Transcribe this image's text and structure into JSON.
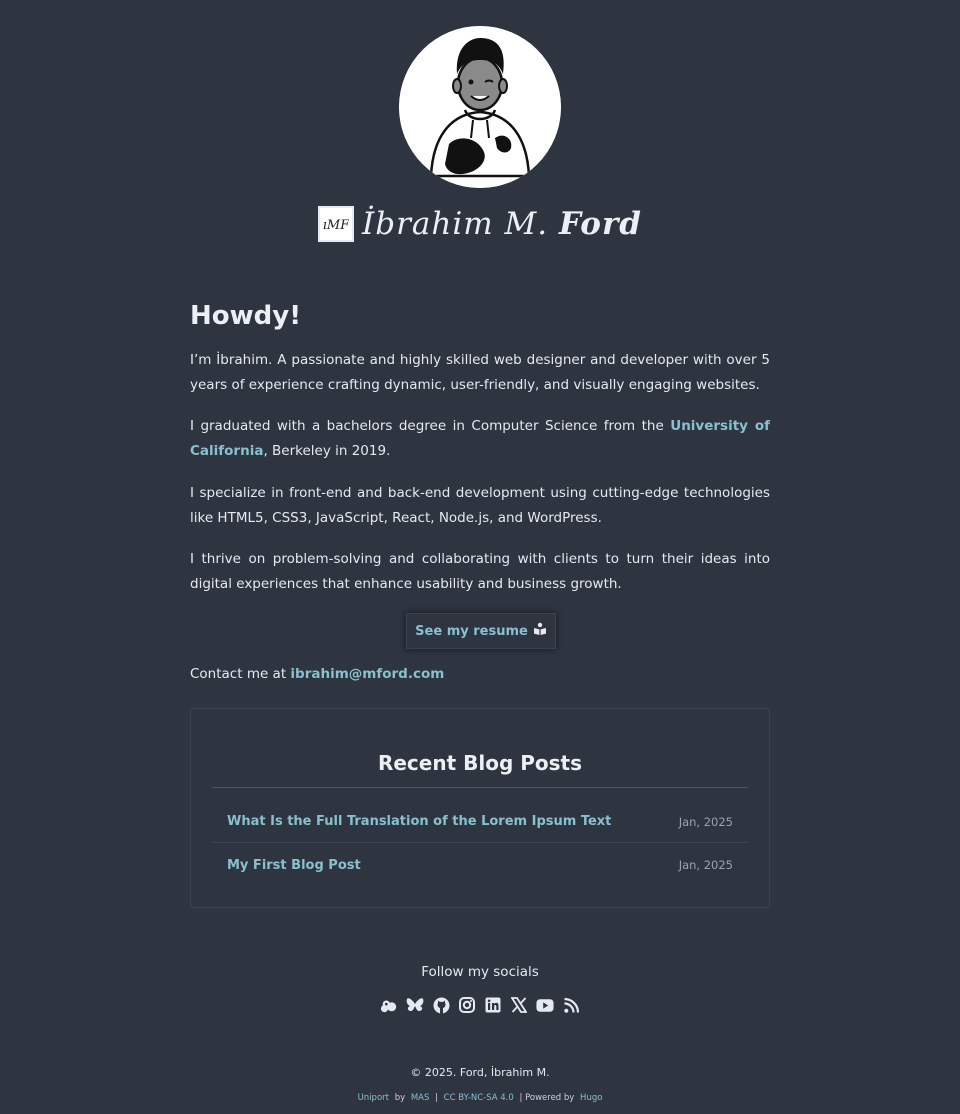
{
  "header": {
    "site_name_part1": "İbrahim M.",
    "site_name_part2": "Ford"
  },
  "main": {
    "heading": "Howdy!",
    "p1": "I’m İbrahim. A passionate and highly skilled web designer and developer with over 5 years of experience crafting dynamic, user-friendly, and visually engaging websites.",
    "p2_before": "I graduated with a bachelors degree in Computer Science from the ",
    "p2_link": "University of California",
    "p2_after": ", Berkeley in 2019.",
    "p3": "I specialize in front-end and back-end development using cutting-edge technologies like HTML5, CSS3, JavaScript, React, Node.js, and WordPress.",
    "p4": "I thrive on problem-solving and collaborating with clients to turn their ideas into digital experiences that enhance usability and business growth.",
    "resume_label": "See my resume",
    "contact_prefix": "Contact me at ",
    "contact_email": "ibrahim@mford.com"
  },
  "blog": {
    "heading": "Recent Blog Posts",
    "posts": [
      {
        "title": "What Is the Full Translation of the Lorem Ipsum Text",
        "date": "Jan, 2025"
      },
      {
        "title": "My First Blog Post",
        "date": "Jan, 2025"
      }
    ]
  },
  "socials": {
    "label": "Follow my socials",
    "icons": [
      "mastodon-icon",
      "bluesky-icon",
      "github-icon",
      "instagram-icon",
      "linkedin-icon",
      "x-icon",
      "youtube-icon",
      "rss-icon"
    ]
  },
  "footer": {
    "copyright": "© 2025. Ford, İbrahim M.",
    "theme": "Uniport",
    "by": "by",
    "author": "MAS",
    "sep1": "|",
    "license": "CC BY-NC-SA 4.0",
    "powered": "| Powered by",
    "engine": "Hugo"
  },
  "colors": {
    "background": "#2e3440",
    "accent": "#88c0d0",
    "text": "#e5e9f0"
  }
}
